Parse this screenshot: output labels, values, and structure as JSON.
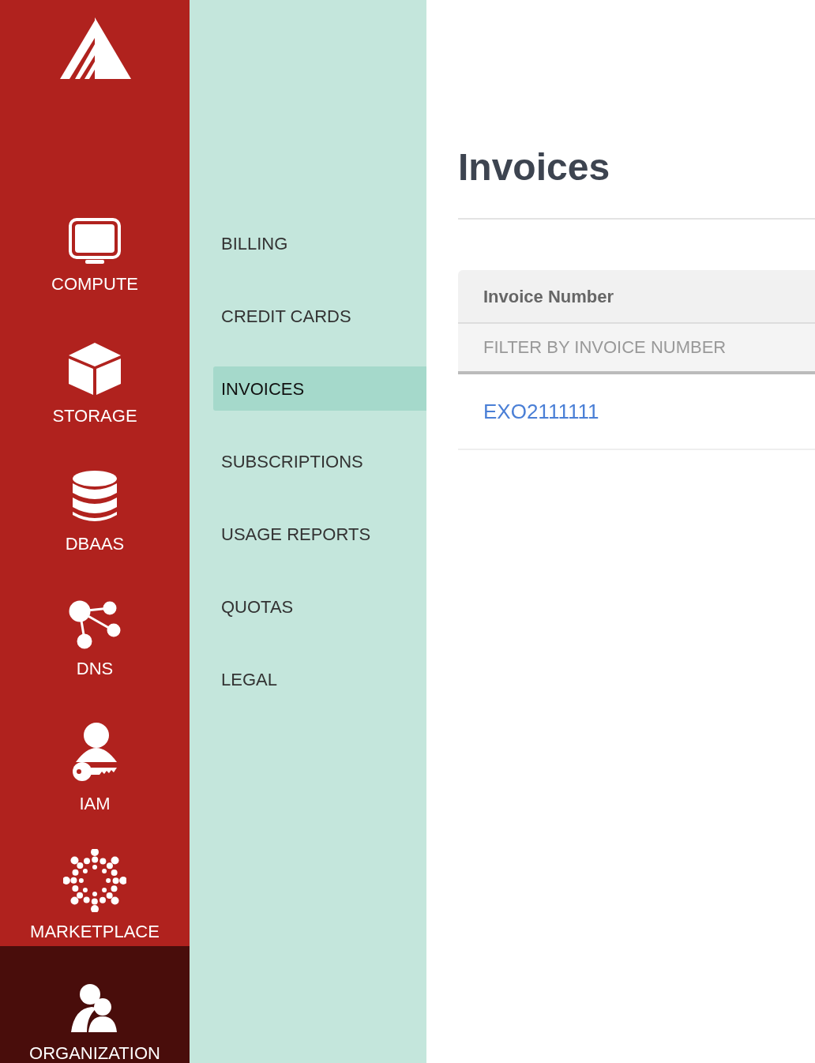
{
  "rail": {
    "items": [
      {
        "label": "COMPUTE",
        "selected": false
      },
      {
        "label": "STORAGE",
        "selected": false
      },
      {
        "label": "DBAAS",
        "selected": false
      },
      {
        "label": "DNS",
        "selected": false
      },
      {
        "label": "IAM",
        "selected": false
      },
      {
        "label": "MARKETPLACE",
        "selected": false
      },
      {
        "label": "ORGANIZATION",
        "selected": true
      }
    ]
  },
  "subnav": {
    "items": [
      {
        "label": "BILLING",
        "selected": false
      },
      {
        "label": "CREDIT CARDS",
        "selected": false
      },
      {
        "label": "INVOICES",
        "selected": true
      },
      {
        "label": "SUBSCRIPTIONS",
        "selected": false
      },
      {
        "label": "USAGE REPORTS",
        "selected": false
      },
      {
        "label": "QUOTAS",
        "selected": false
      },
      {
        "label": "LEGAL",
        "selected": false
      }
    ]
  },
  "page": {
    "title": "Invoices"
  },
  "table": {
    "columns": [
      "Invoice Number"
    ],
    "filter": {
      "placeholder": "FILTER BY INVOICE NUMBER"
    },
    "rows": [
      [
        "EXO2111111"
      ]
    ]
  }
}
